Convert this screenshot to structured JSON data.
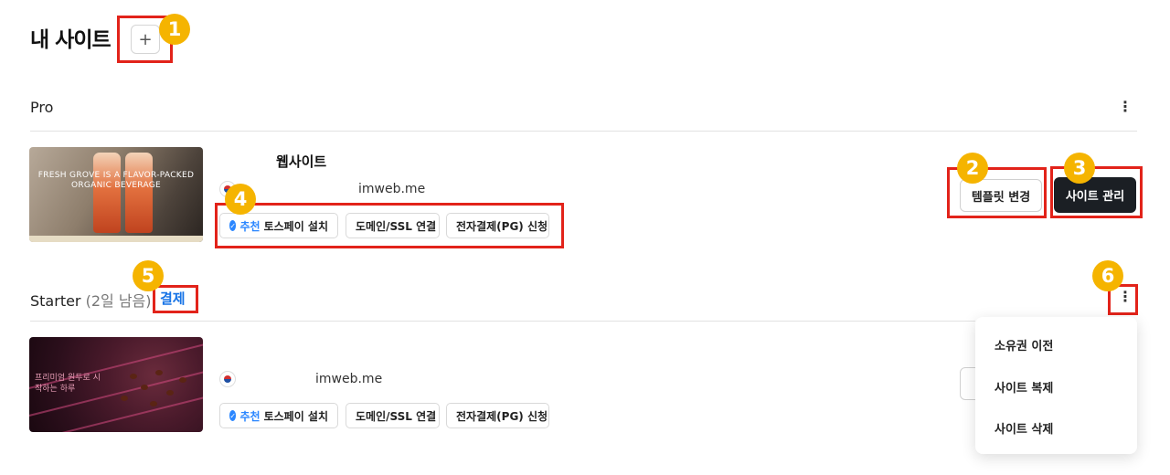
{
  "header": {
    "title": "내 사이트",
    "add_label": "+"
  },
  "badges": [
    "1",
    "2",
    "3",
    "4",
    "5",
    "6"
  ],
  "sections": [
    {
      "plan": "Pro",
      "menu_icon": "more-vertical-icon",
      "site": {
        "thumbnail_text": "FRESH GROVE IS A FLAVOR-PACKED ORGANIC BEVERAGE",
        "name": "웹사이트",
        "domain": "imweb.me",
        "chips": {
          "recommend": "추천",
          "tosspay": "토스페이 설치",
          "domain_ssl": "도메인/SSL 연결",
          "pg": "전자결제(PG) 신청"
        },
        "buttons": {
          "change_template": "템플릿 변경",
          "manage_site": "사이트 관리"
        }
      }
    },
    {
      "plan": "Starter",
      "remaining": "(2일 남음)",
      "pay_label": "결제",
      "menu_icon": "more-vertical-icon",
      "site": {
        "thumbnail_text": "프리미엄 원두로 시작하는 하루",
        "domain": "imweb.me",
        "chips": {
          "recommend": "추천",
          "tosspay": "토스페이 설치",
          "domain_ssl": "도메인/SSL 연결",
          "pg": "전자결제(PG) 신청"
        }
      }
    }
  ],
  "dropdown": {
    "items": [
      "소유권 이전",
      "사이트 복제",
      "사이트 삭제"
    ]
  },
  "colors": {
    "highlight": "#e2231a",
    "badge": "#f5b400",
    "accent": "#2a86ff",
    "dark_button": "#1b1f24"
  }
}
